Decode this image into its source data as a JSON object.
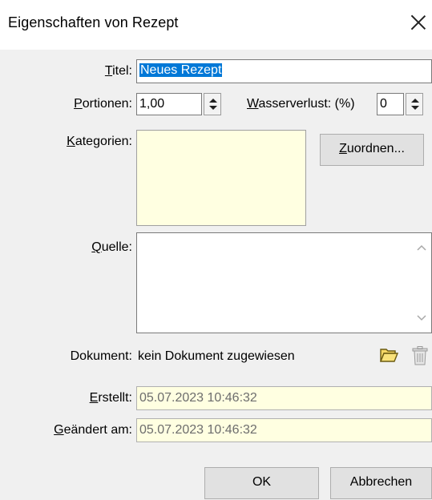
{
  "window": {
    "title": "Eigenschaften von Rezept"
  },
  "form": {
    "titel": {
      "prefix": "",
      "accel": "T",
      "rest": "itel:",
      "value": "Neues Rezept"
    },
    "portionen": {
      "accel": "P",
      "rest": "ortionen:",
      "value": "1,00"
    },
    "wasserverlust": {
      "accel": "W",
      "rest": "asserverlust: (%)",
      "value": "0"
    },
    "kategorien": {
      "accel": "K",
      "rest": "ategorien:",
      "values": []
    },
    "zuordnen": {
      "accel": "Z",
      "rest": "uordnen..."
    },
    "quelle": {
      "accel": "Q",
      "rest": "uelle:",
      "value": ""
    },
    "dokument": {
      "label": "Dokument:",
      "value": "kein Dokument zugewiesen"
    },
    "erstellt": {
      "accel": "E",
      "rest": "rstellt:",
      "value": "05.07.2023 10:46:32"
    },
    "geaendert": {
      "accel": "G",
      "rest": "eändert am:",
      "value": "05.07.2023 10:46:32"
    }
  },
  "buttons": {
    "ok": "OK",
    "cancel": "Abbrechen"
  },
  "icons": {
    "open_folder": "folder-open-icon",
    "delete": "trash-icon"
  },
  "colors": {
    "readonly_bg": "#ffffe1",
    "selection": "#0078d7"
  }
}
